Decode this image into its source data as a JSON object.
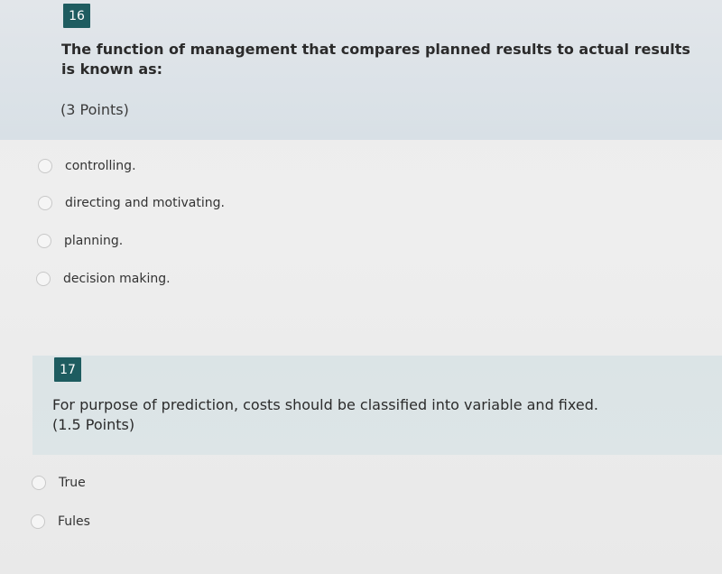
{
  "questions": [
    {
      "number": "16",
      "text": "The function of management that compares planned results to actual results is known as:",
      "points": "(3 Points)",
      "options": [
        "controlling.",
        "directing and motivating.",
        "planning.",
        "decision making."
      ]
    },
    {
      "number": "17",
      "text": "For purpose of prediction, costs should be classified into variable and fixed.",
      "points": "(1.5 Points)",
      "options": [
        "True",
        "Fules"
      ]
    }
  ]
}
